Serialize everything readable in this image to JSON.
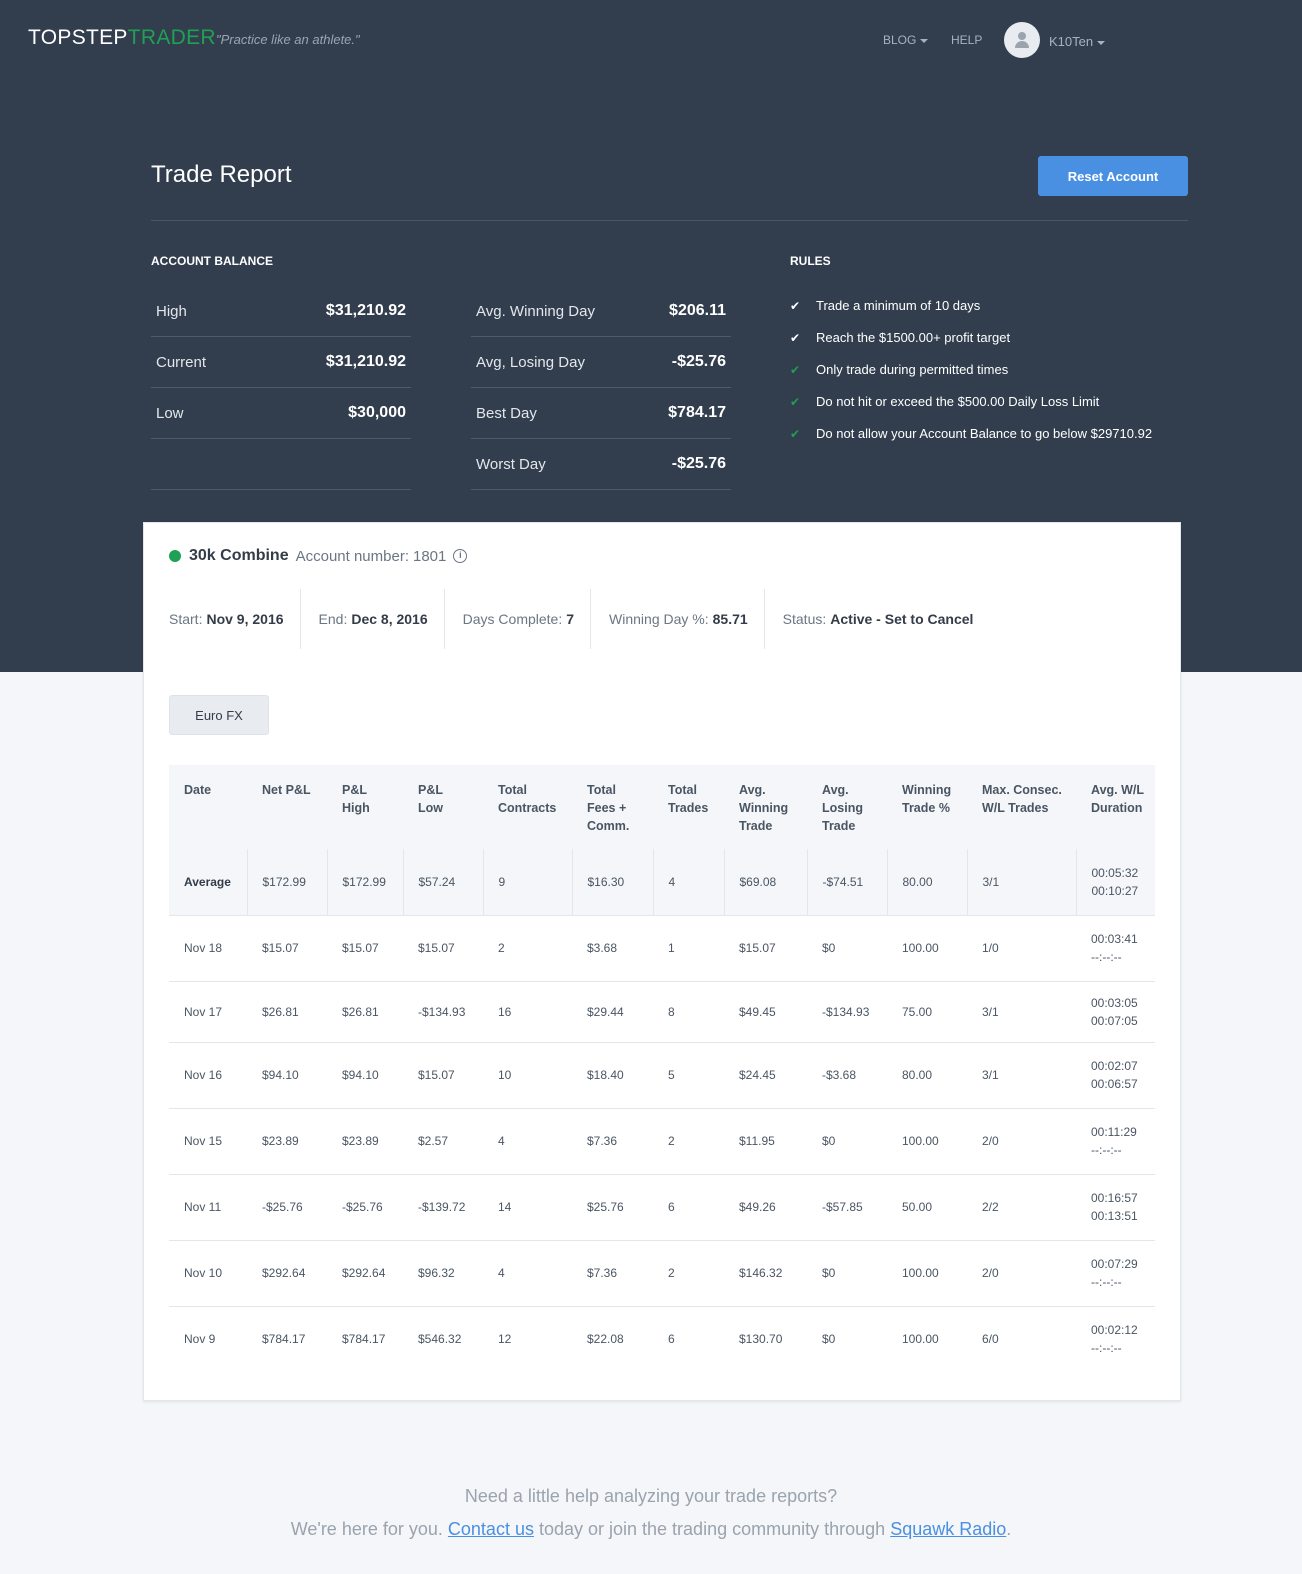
{
  "nav": {
    "logo_part1": "TOPSTEP",
    "logo_part2": "TRADER",
    "tagline": "\"Practice like an athlete.\"",
    "blog": "BLOG",
    "help": "HELP",
    "user": "K10Ten"
  },
  "header": {
    "title": "Trade Report",
    "reset_button": "Reset Account"
  },
  "account_balance": {
    "title": "ACCOUNT BALANCE",
    "left": [
      {
        "label": "High",
        "value": "$31,210.92"
      },
      {
        "label": "Current",
        "value": "$31,210.92"
      },
      {
        "label": "Low",
        "value": "$30,000"
      }
    ],
    "right": [
      {
        "label": "Avg. Winning Day",
        "value": "$206.11"
      },
      {
        "label": "Avg, Losing Day",
        "value": "-$25.76"
      },
      {
        "label": "Best Day",
        "value": "$784.17"
      },
      {
        "label": "Worst Day",
        "value": "-$25.76"
      }
    ]
  },
  "rules": {
    "title": "RULES",
    "items": [
      {
        "text": "Trade a minimum of 10 days",
        "met": false
      },
      {
        "text": "Reach the $1500.00+ profit target",
        "met": false
      },
      {
        "text": "Only trade during permitted times",
        "met": true
      },
      {
        "text": "Do not hit or exceed the $500.00 Daily Loss Limit",
        "met": true
      },
      {
        "text": "Do not allow your Account Balance to go below $29710.92",
        "met": true
      }
    ]
  },
  "combine": {
    "name": "30k Combine",
    "account_label": "Account number:",
    "account_number": "1801",
    "status_color": "#1fa055",
    "meta": [
      {
        "key": "Start:",
        "value": "Nov 9, 2016"
      },
      {
        "key": "End:",
        "value": "Dec 8, 2016"
      },
      {
        "key": "Days Complete:",
        "value": "7"
      },
      {
        "key": "Winning Day %:",
        "value": "85.71"
      },
      {
        "key": "Status:",
        "value": "Active - Set to Cancel"
      }
    ],
    "instrument_tab": "Euro FX"
  },
  "table": {
    "headers": [
      [
        "Date"
      ],
      [
        "Net P&L"
      ],
      [
        "P&L",
        "High"
      ],
      [
        "P&L",
        "Low"
      ],
      [
        "Total",
        "Contracts"
      ],
      [
        "Total",
        "Fees +",
        "Comm."
      ],
      [
        "Total",
        "Trades"
      ],
      [
        "Avg.",
        "Winning",
        "Trade"
      ],
      [
        "Avg.",
        "Losing",
        "Trade"
      ],
      [
        "Winning",
        "Trade %"
      ],
      [
        "Max. Consec.",
        "W/L Trades"
      ],
      [
        "Avg. W/L",
        "Duration"
      ]
    ],
    "rows": [
      [
        "Average",
        "$172.99",
        "$172.99",
        "$57.24",
        "9",
        "$16.30",
        "4",
        "$69.08",
        "-$74.51",
        "80.00",
        "3/1",
        "00:05:32",
        "00:10:27"
      ],
      [
        "Nov 18",
        "$15.07",
        "$15.07",
        "$15.07",
        "2",
        "$3.68",
        "1",
        "$15.07",
        "$0",
        "100.00",
        "1/0",
        "00:03:41",
        "--:--:--"
      ],
      [
        "Nov 17",
        "$26.81",
        "$26.81",
        "-$134.93",
        "16",
        "$29.44",
        "8",
        "$49.45",
        "-$134.93",
        "75.00",
        "3/1",
        "00:03:05",
        "00:07:05"
      ],
      [
        "Nov 16",
        "$94.10",
        "$94.10",
        "$15.07",
        "10",
        "$18.40",
        "5",
        "$24.45",
        "-$3.68",
        "80.00",
        "3/1",
        "00:02:07",
        "00:06:57"
      ],
      [
        "Nov 15",
        "$23.89",
        "$23.89",
        "$2.57",
        "4",
        "$7.36",
        "2",
        "$11.95",
        "$0",
        "100.00",
        "2/0",
        "00:11:29",
        "--:--:--"
      ],
      [
        "Nov 11",
        "-$25.76",
        "-$25.76",
        "-$139.72",
        "14",
        "$25.76",
        "6",
        "$49.26",
        "-$57.85",
        "50.00",
        "2/2",
        "00:16:57",
        "00:13:51"
      ],
      [
        "Nov 10",
        "$292.64",
        "$292.64",
        "$96.32",
        "4",
        "$7.36",
        "2",
        "$146.32",
        "$0",
        "100.00",
        "2/0",
        "00:07:29",
        "--:--:--"
      ],
      [
        "Nov 9",
        "$784.17",
        "$784.17",
        "$546.32",
        "12",
        "$22.08",
        "6",
        "$130.70",
        "$0",
        "100.00",
        "6/0",
        "00:02:12",
        "--:--:--"
      ]
    ]
  },
  "footer": {
    "line1": "Need a little help analyzing your trade reports?",
    "line2_a": "We're here for you.",
    "contact_link": "Contact us",
    "line2_b": "today or join the trading community through",
    "squawk_link": "Squawk Radio",
    "line2_c": "."
  }
}
